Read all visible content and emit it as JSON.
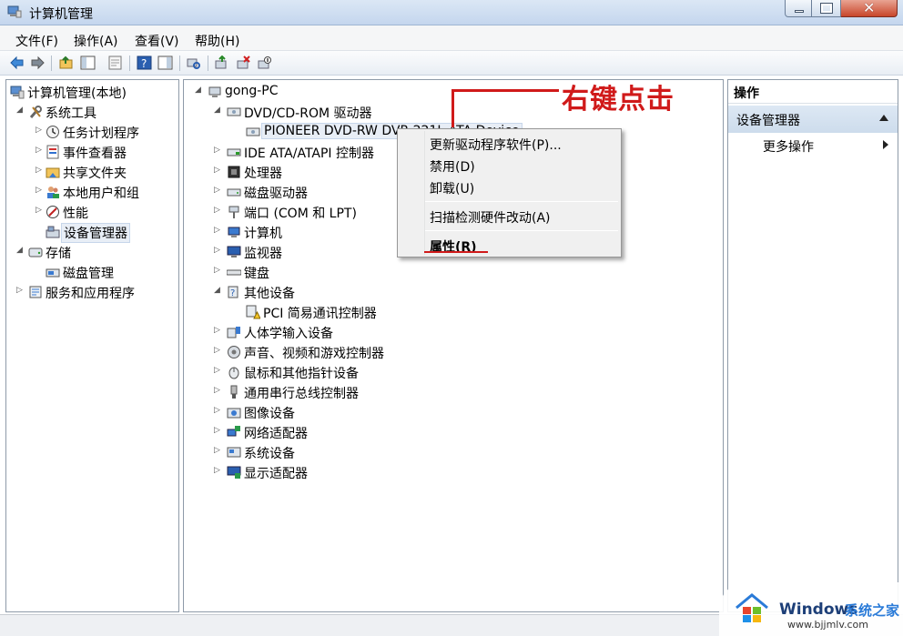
{
  "window": {
    "title": "计算机管理"
  },
  "menu": [
    "文件(F)",
    "操作(A)",
    "查看(V)",
    "帮助(H)"
  ],
  "left_tree": {
    "root": "计算机管理(本地)",
    "system_tools": "系统工具",
    "task_scheduler": "任务计划程序",
    "event_viewer": "事件查看器",
    "shared_folders": "共享文件夹",
    "local_users": "本地用户和组",
    "performance": "性能",
    "device_manager": "设备管理器",
    "storage": "存储",
    "disk_management": "磁盘管理",
    "services_apps": "服务和应用程序"
  },
  "device_tree": {
    "root": "gong-PC",
    "dvd": "DVD/CD-ROM 驱动器",
    "dvd_device": "PIONEER DVD-RW  DVR-221L ATA Device",
    "ide": "IDE ATA/ATAPI 控制器",
    "cpu": "处理器",
    "disk": "磁盘驱动器",
    "ports": "端口 (COM 和 LPT)",
    "computer": "计算机",
    "monitors": "监视器",
    "keyboard": "键盘",
    "other": "其他设备",
    "pci": "PCI 简易通讯控制器",
    "hid": "人体学输入设备",
    "sound": "声音、视频和游戏控制器",
    "mouse": "鼠标和其他指针设备",
    "usb": "通用串行总线控制器",
    "imaging": "图像设备",
    "network": "网络适配器",
    "system": "系统设备",
    "display": "显示适配器"
  },
  "context_menu": {
    "update": "更新驱动程序软件(P)...",
    "disable": "禁用(D)",
    "uninstall": "卸载(U)",
    "scan": "扫描检测硬件改动(A)",
    "properties": "属性(R)"
  },
  "annotation": {
    "text": "右键点击"
  },
  "actions": {
    "header": "操作",
    "section": "设备管理器",
    "more": "更多操作"
  },
  "watermark": {
    "brand": "Windows",
    "site_cn": "系统之家",
    "url": "www.bjjmlv.com"
  },
  "colors": {
    "annotation": "#d01a1a",
    "title_bg": "#c4d6ee",
    "selection": "#e8eef6"
  }
}
